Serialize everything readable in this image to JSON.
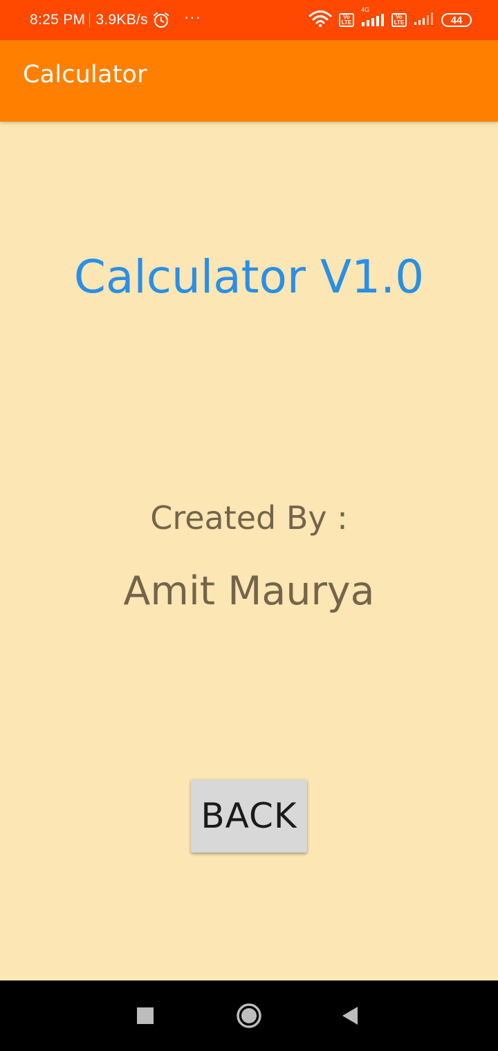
{
  "status_bar": {
    "time": "8:25 PM",
    "network_speed": "3.9KB/s",
    "overflow": "···",
    "network_type": "4G",
    "volte_1": [
      "Vo",
      "LTE"
    ],
    "volte_2": [
      "Vo",
      "LTE"
    ],
    "battery": "44",
    "icons": [
      "alarm-icon",
      "wifi-icon",
      "volte-icon",
      "signal-icon",
      "battery-icon"
    ],
    "background_color": "#ff4800"
  },
  "app_bar": {
    "title": "Calculator",
    "background_color": "#ff8000"
  },
  "main": {
    "version_title": "Calculator V1.0",
    "created_by_label": "Created By :",
    "author_name": "Amit Maurya",
    "back_button_label": "BACK",
    "background_color": "#fbe6b4",
    "title_color": "#2a8fe6",
    "text_color": "#73654b"
  },
  "nav_bar": {
    "icons": [
      "recents-square-icon",
      "home-circle-icon",
      "back-triangle-icon"
    ]
  }
}
